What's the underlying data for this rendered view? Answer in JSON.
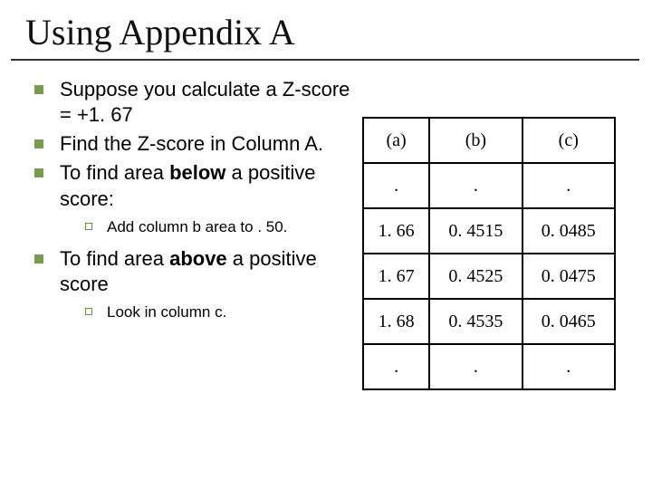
{
  "title": "Using Appendix A",
  "bullets": {
    "b1": "Suppose you calculate a Z-score = +1. 67",
    "b2": "Find the Z-score in Column A.",
    "b3_pre": "To find area ",
    "b3_bold": "below",
    "b3_post": " a positive score:",
    "sub1": "Add column b area to . 50.",
    "b4_pre": "To find area ",
    "b4_bold": "above",
    "b4_post": " a positive score",
    "sub2": "Look in column c."
  },
  "table": {
    "h": {
      "a": "(a)",
      "b": "(b)",
      "c": "(c)"
    },
    "r1": {
      "a": ".",
      "b": ".",
      "c": "."
    },
    "r2": {
      "a": "1. 66",
      "b": "0. 4515",
      "c": "0. 0485"
    },
    "r3": {
      "a": "1. 67",
      "b": "0. 4525",
      "c": "0. 0475"
    },
    "r4": {
      "a": "1. 68",
      "b": "0. 4535",
      "c": "0. 0465"
    },
    "r5": {
      "a": ".",
      "b": ".",
      "c": "."
    }
  }
}
